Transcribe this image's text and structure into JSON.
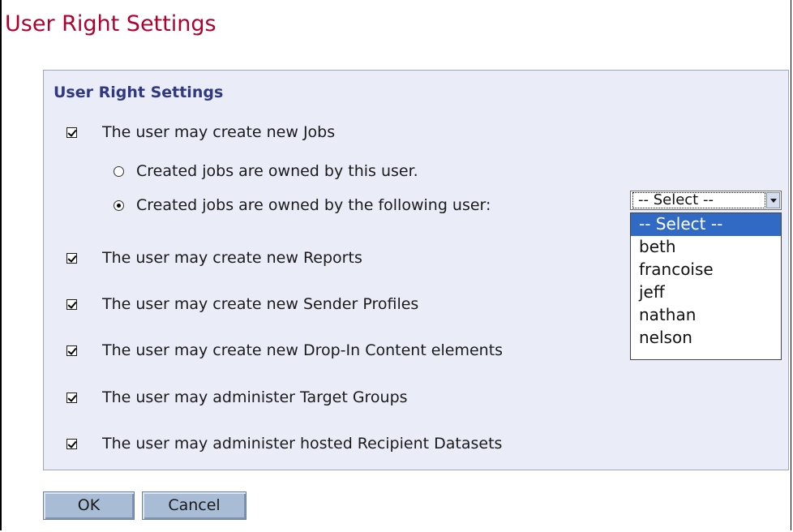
{
  "page": {
    "title": "User Right Settings"
  },
  "panel": {
    "title": "User Right Settings",
    "create_jobs": {
      "label": "The user may create new Jobs",
      "checked": true
    },
    "ownership": {
      "option_self": {
        "label": "Created jobs are owned by this user.",
        "selected": false
      },
      "option_other": {
        "label": "Created jobs are owned by the following user:",
        "selected": true
      },
      "select": {
        "value": "-- Select --",
        "options": [
          "-- Select --",
          "beth",
          "francoise",
          "jeff",
          "nathan",
          "nelson"
        ],
        "highlighted_option": "-- Select --"
      }
    },
    "permissions": [
      {
        "label": "The user may create new Reports",
        "checked": true
      },
      {
        "label": "The user may create new Sender Profiles",
        "checked": true
      },
      {
        "label": "The user may create new Drop-In Content elements",
        "checked": true
      },
      {
        "label": "The user may administer Target Groups",
        "checked": true
      },
      {
        "label": "The user may administer hosted Recipient Datasets",
        "checked": true
      }
    ]
  },
  "buttons": {
    "ok": "OK",
    "cancel": "Cancel"
  },
  "colors": {
    "title": "#b0002e",
    "panel_bg": "#eaecf7",
    "panel_title": "#303880",
    "button_bg": "#a8bcd6",
    "option_highlight": "#316ac5"
  }
}
